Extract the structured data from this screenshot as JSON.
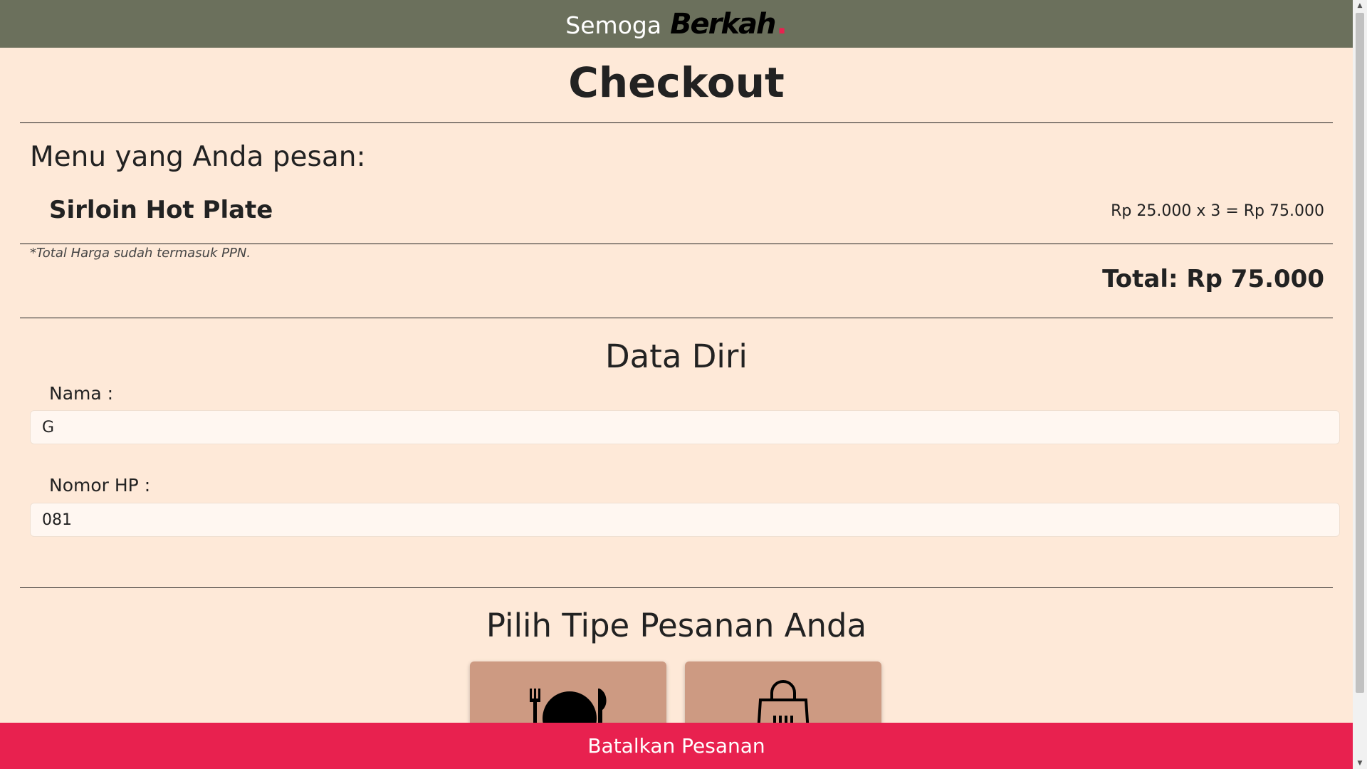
{
  "header": {
    "brand_light": "Semoga",
    "brand_bold": "Berkah",
    "brand_dot": "."
  },
  "page_title": "Checkout",
  "order": {
    "heading": "Menu yang Anda pesan:",
    "items": [
      {
        "name": "Sirloin Hot Plate",
        "calc": "Rp 25.000 x 3 = Rp 75.000"
      }
    ],
    "ppn_note": "*Total Harga sudah termasuk PPN.",
    "total": "Total: Rp 75.000"
  },
  "personal": {
    "title": "Data Diri",
    "name_label": "Nama :",
    "name_value": "G",
    "phone_label": "Nomor HP :",
    "phone_value": "081"
  },
  "order_type": {
    "title": "Pilih Tipe Pesanan Anda",
    "options": [
      {
        "icon": "dine-in-icon"
      },
      {
        "icon": "shopping-bag-icon"
      }
    ]
  },
  "cancel_button": "Batalkan Pesanan",
  "colors": {
    "header_bg": "#6b705c",
    "page_bg": "#fee9d8",
    "accent_red": "#e8214f",
    "card_bg": "#cd9a82"
  }
}
